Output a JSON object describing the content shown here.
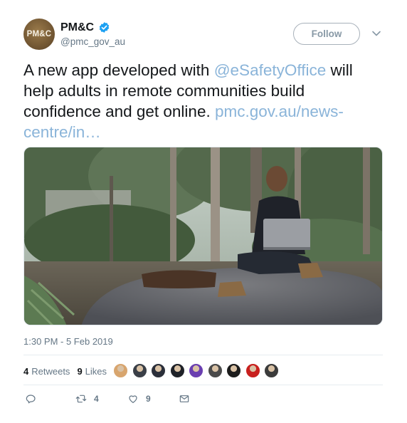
{
  "author": {
    "avatar_text": "PM&C",
    "display_name": "PM&C",
    "handle": "@pmc_gov_au",
    "verified": true
  },
  "follow_label": "Follow",
  "tweet": {
    "text_before": "A new app developed with ",
    "mention": "@eSafetyOffice",
    "text_after": " will help adults in remote communities build confidence and get online. ",
    "link": "pmc.gov.au/news-centre/in…"
  },
  "media": {
    "icon": "photo-man-with-laptop-in-bushland"
  },
  "timestamp": "1:30 PM - 5 Feb 2019",
  "stats": {
    "retweets_count": "4",
    "retweets_label": "Retweets",
    "likes_count": "9",
    "likes_label": "Likes"
  },
  "facepile": {
    "count": 9,
    "colors": [
      "#d8a56e",
      "#3a3f47",
      "#2b2f3a",
      "#1f2228",
      "#6a3fb0",
      "#4a4a4a",
      "#1c1c1c",
      "#c8201e",
      "#3b3b3b"
    ]
  },
  "actions": {
    "reply_icon": "reply-icon",
    "retweet_icon": "retweet-icon",
    "retweet_count": "4",
    "like_icon": "heart-icon",
    "like_count": "9",
    "message_icon": "envelope-icon"
  },
  "colors": {
    "link": "#8ab4d9",
    "verified": "#1da1f2",
    "muted": "#657786"
  }
}
